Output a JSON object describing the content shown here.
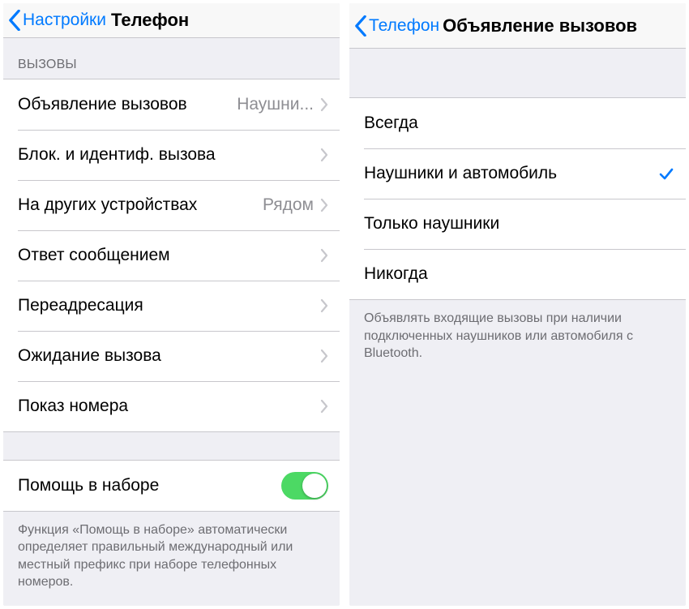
{
  "left": {
    "back": "Настройки",
    "title": "Телефон",
    "section": "ВЫЗОВЫ",
    "rows": [
      {
        "label": "Объявление вызовов",
        "value": "Наушни..."
      },
      {
        "label": "Блок. и идентиф. вызова",
        "value": ""
      },
      {
        "label": "На других устройствах",
        "value": "Рядом"
      },
      {
        "label": "Ответ сообщением",
        "value": ""
      },
      {
        "label": "Переадресация",
        "value": ""
      },
      {
        "label": "Ожидание вызова",
        "value": ""
      },
      {
        "label": "Показ номера",
        "value": ""
      }
    ],
    "toggle_row": {
      "label": "Помощь в наборе",
      "on": true
    },
    "footer": "Функция «Помощь в наборе» автоматически определяет правильный международный или местный префикс при наборе телефонных номеров."
  },
  "right": {
    "back": "Телефон",
    "title": "Объявление вызовов",
    "options": [
      {
        "label": "Всегда",
        "selected": false
      },
      {
        "label": "Наушники и автомобиль",
        "selected": true
      },
      {
        "label": "Только наушники",
        "selected": false
      },
      {
        "label": "Никогда",
        "selected": false
      }
    ],
    "footer": "Объявлять входящие вызовы при наличии подключенных наушников или автомобиля с Bluetooth."
  }
}
